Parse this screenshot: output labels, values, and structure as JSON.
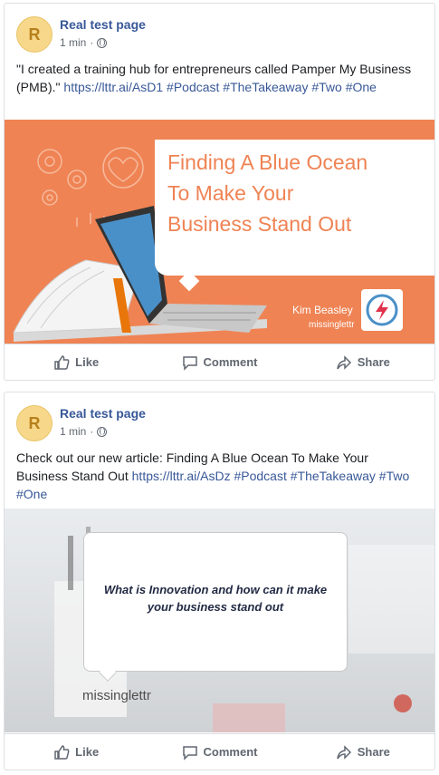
{
  "posts": [
    {
      "page_name": "Real test page",
      "avatar_letter": "R",
      "time": "1 min",
      "text": "\"I created a training hub for entrepreneurs called Pamper My Business (PMB).\"",
      "link": "https://lttr.ai/AsD1",
      "hashtags": "#Podcast #TheTakeaway #Two #One",
      "image": {
        "headline_line1": "Finding A Blue Ocean",
        "headline_line2": "To Make Your",
        "headline_line3": "Business Stand Out",
        "author": "Kim Beasley",
        "brand": "missinglettr"
      },
      "actions": {
        "like": "Like",
        "comment": "Comment",
        "share": "Share"
      }
    },
    {
      "page_name": "Real test page",
      "avatar_letter": "R",
      "time": "1 min",
      "text": "Check out our new article: Finding A Blue Ocean To Make Your Business Stand Out",
      "link": "https://lttr.ai/AsDz",
      "hashtags": "#Podcast #TheTakeaway #Two #One",
      "image": {
        "quote": "What is Innovation and how can it make your business stand out",
        "brand": "missinglettr"
      },
      "actions": {
        "like": "Like",
        "comment": "Comment",
        "share": "Share"
      }
    }
  ],
  "colors": {
    "link": "#385898",
    "accent_orange": "#ef8354",
    "avatar": "#f7d78a",
    "muted": "#606770"
  }
}
